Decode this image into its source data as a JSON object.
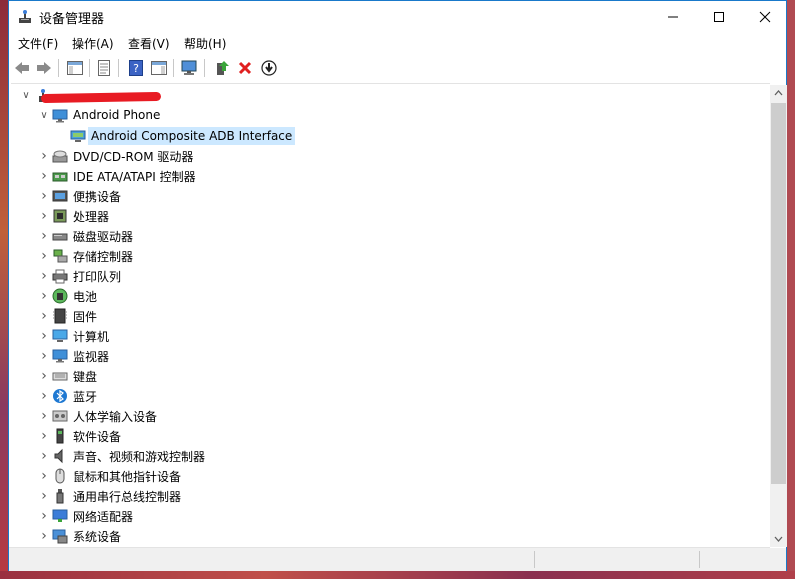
{
  "window": {
    "title": "设备管理器"
  },
  "menu": [
    "文件(F)",
    "操作(A)",
    "查看(V)",
    "帮助(H)"
  ],
  "tree": {
    "root_label": "",
    "items": [
      {
        "label": "Android Phone",
        "expanded": true,
        "icon": "monitor-icon"
      },
      {
        "label": "Android Composite ADB Interface",
        "child": true,
        "selected": true,
        "icon": "device-icon"
      },
      {
        "label": "DVD/CD-ROM 驱动器",
        "icon": "disc-drive-icon"
      },
      {
        "label": "IDE ATA/ATAPI 控制器",
        "icon": "ide-controller-icon"
      },
      {
        "label": "便携设备",
        "icon": "portable-device-icon"
      },
      {
        "label": "处理器",
        "icon": "processor-icon"
      },
      {
        "label": "磁盘驱动器",
        "icon": "disk-drive-icon"
      },
      {
        "label": "存储控制器",
        "icon": "storage-controller-icon"
      },
      {
        "label": "打印队列",
        "icon": "printer-icon"
      },
      {
        "label": "电池",
        "icon": "battery-icon"
      },
      {
        "label": "固件",
        "icon": "firmware-icon"
      },
      {
        "label": "计算机",
        "icon": "computer-icon"
      },
      {
        "label": "监视器",
        "icon": "monitor-icon"
      },
      {
        "label": "键盘",
        "icon": "keyboard-icon"
      },
      {
        "label": "蓝牙",
        "icon": "bluetooth-icon"
      },
      {
        "label": "人体学输入设备",
        "icon": "hid-icon"
      },
      {
        "label": "软件设备",
        "icon": "software-device-icon"
      },
      {
        "label": "声音、视频和游戏控制器",
        "icon": "speaker-icon"
      },
      {
        "label": "鼠标和其他指针设备",
        "icon": "mouse-icon"
      },
      {
        "label": "通用串行总线控制器",
        "icon": "usb-icon"
      },
      {
        "label": "网络适配器",
        "icon": "network-adapter-icon"
      },
      {
        "label": "系统设备",
        "icon": "system-device-icon"
      }
    ]
  },
  "colors": {
    "selection": "#cce8ff",
    "accent": "#1979ca",
    "redaction": "#e81b23"
  }
}
